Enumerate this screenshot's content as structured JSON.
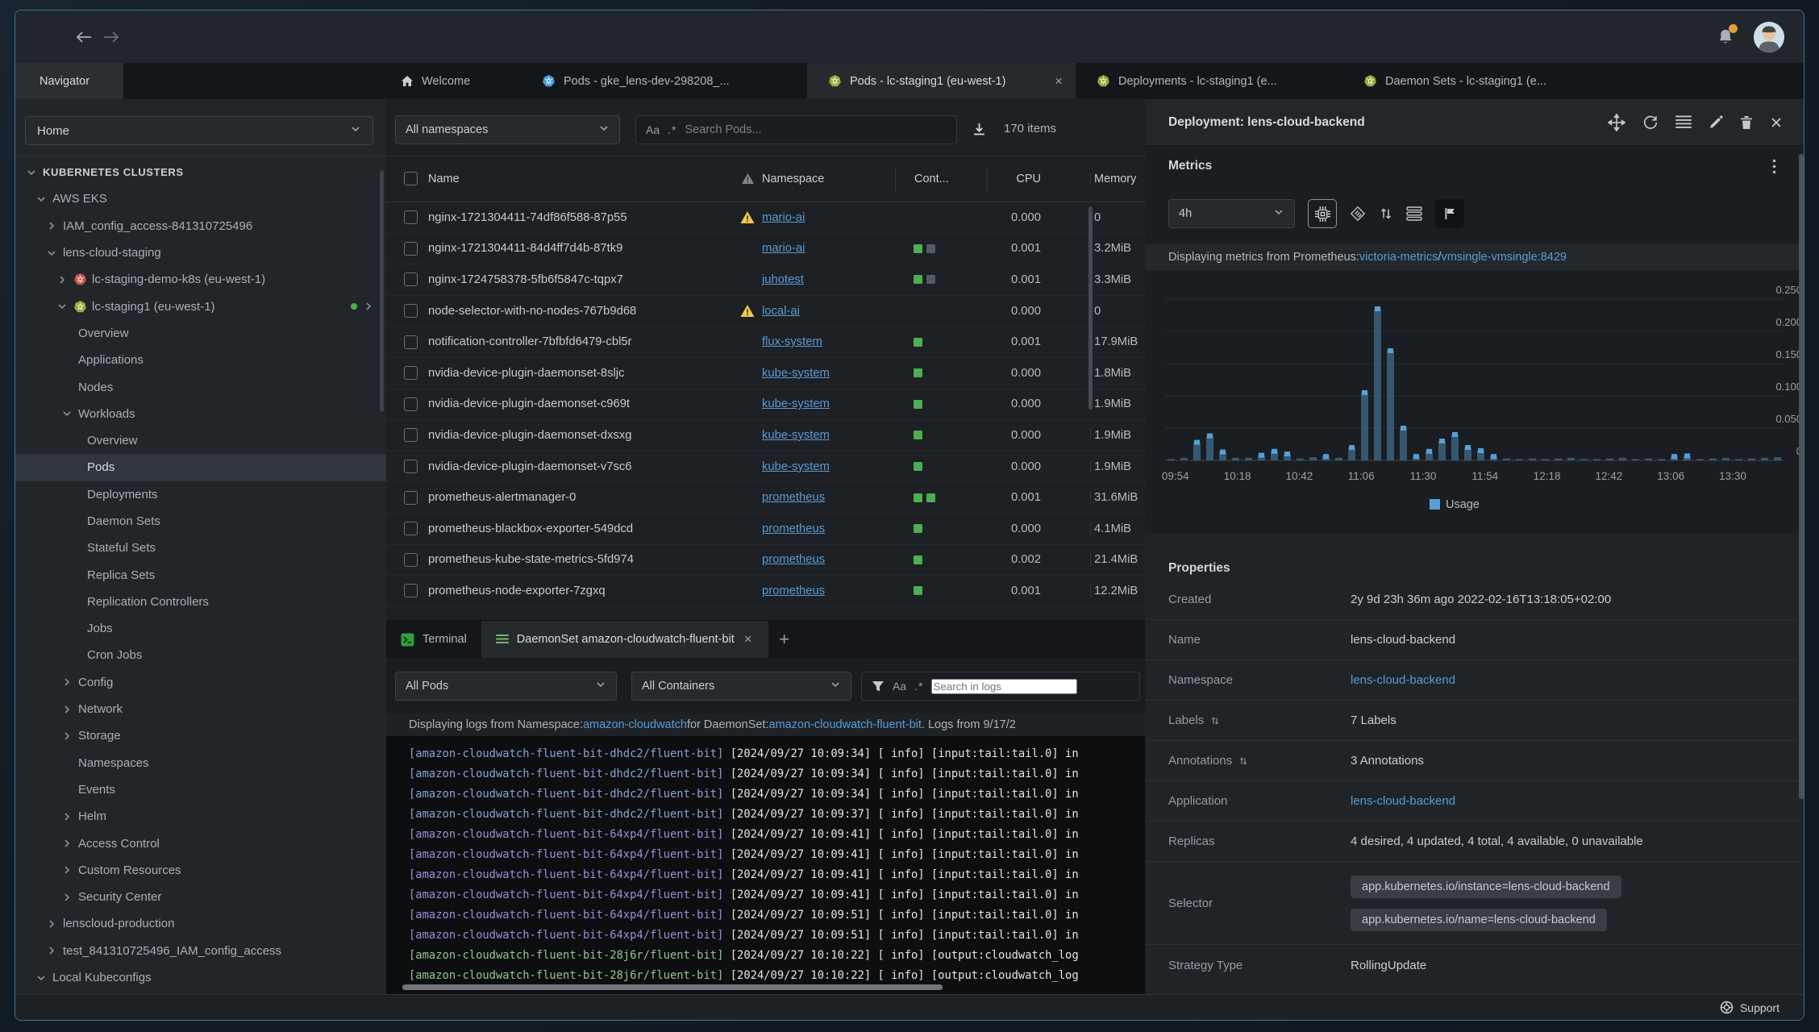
{
  "tabstrip": {
    "navigator_label": "Navigator",
    "tabs": [
      {
        "id": "welcome",
        "icon": "home",
        "label": "Welcome",
        "active": false,
        "closable": false
      },
      {
        "id": "pods-gke",
        "icon": "k8s-blue",
        "label": "Pods - gke_lens-dev-298208_...",
        "active": false,
        "closable": false
      },
      {
        "id": "pods-lc-staging1",
        "icon": "k8s-green",
        "label": "Pods - lc-staging1 (eu-west-1)",
        "active": true,
        "closable": true
      },
      {
        "id": "deployments-lc-staging1",
        "icon": "k8s-green",
        "label": "Deployments - lc-staging1 (e...",
        "active": false,
        "closable": false
      },
      {
        "id": "daemonsets-lc-staging1",
        "icon": "k8s-green",
        "label": "Daemon Sets - lc-staging1 (e...",
        "active": false,
        "closable": false
      }
    ]
  },
  "sidebar": {
    "catalog_value": "Home",
    "tree": [
      {
        "label": "KUBERNETES CLUSTERS",
        "indent": 12,
        "chevron": "down",
        "section": true
      },
      {
        "label": "AWS EKS",
        "indent": 24,
        "chevron": "down"
      },
      {
        "label": "IAM_config_access-841310725496",
        "indent": 37,
        "chevron": "right"
      },
      {
        "label": "lens-cloud-staging",
        "indent": 37,
        "chevron": "down"
      },
      {
        "label": "lc-staging-demo-k8s (eu-west-1)",
        "indent": 50,
        "chevron": "right",
        "icon": "k8s-red"
      },
      {
        "label": "lc-staging1 (eu-west-1)",
        "indent": 50,
        "chevron": "down",
        "icon": "k8s-green",
        "status_dot": true
      },
      {
        "label": "Overview",
        "indent": 56
      },
      {
        "label": "Applications",
        "indent": 56
      },
      {
        "label": "Nodes",
        "indent": 56
      },
      {
        "label": "Workloads",
        "indent": 56,
        "chevron": "down"
      },
      {
        "label": "Overview",
        "indent": 67
      },
      {
        "label": "Pods",
        "indent": 67,
        "selected": true
      },
      {
        "label": "Deployments",
        "indent": 67
      },
      {
        "label": "Daemon Sets",
        "indent": 67
      },
      {
        "label": "Stateful Sets",
        "indent": 67
      },
      {
        "label": "Replica Sets",
        "indent": 67
      },
      {
        "label": "Replication Controllers",
        "indent": 67
      },
      {
        "label": "Jobs",
        "indent": 67
      },
      {
        "label": "Cron Jobs",
        "indent": 67
      },
      {
        "label": "Config",
        "indent": 56,
        "chevron": "right"
      },
      {
        "label": "Network",
        "indent": 56,
        "chevron": "right"
      },
      {
        "label": "Storage",
        "indent": 56,
        "chevron": "right"
      },
      {
        "label": "Namespaces",
        "indent": 56
      },
      {
        "label": "Events",
        "indent": 56
      },
      {
        "label": "Helm",
        "indent": 56,
        "chevron": "right"
      },
      {
        "label": "Access Control",
        "indent": 56,
        "chevron": "right"
      },
      {
        "label": "Custom Resources",
        "indent": 56,
        "chevron": "right"
      },
      {
        "label": "Security Center",
        "indent": 56,
        "chevron": "right"
      },
      {
        "label": "lenscloud-production",
        "indent": 37,
        "chevron": "right"
      },
      {
        "label": "test_841310725496_IAM_config_access",
        "indent": 37,
        "chevron": "right"
      },
      {
        "label": "Local Kubeconfigs",
        "indent": 24,
        "chevron": "down"
      }
    ]
  },
  "pods_view": {
    "namespace_filter": "All namespaces",
    "match_case_glyph": "Aa",
    "regex_glyph": ".*",
    "search_placeholder": "Search Pods...",
    "items_count": "170 items",
    "columns": {
      "name": "Name",
      "namespace": "Namespace",
      "containers": "Cont...",
      "cpu": "CPU",
      "memory": "Memory"
    },
    "container_colors": {
      "green": "#4caf50",
      "gray": "#535a61"
    },
    "rows": [
      {
        "name": "nginx-1721304411-74df86f588-87p55",
        "warning": true,
        "namespace": "mario-ai",
        "containers": [],
        "cpu": "0.000",
        "memory": "0"
      },
      {
        "name": "nginx-1721304411-84d4ff7d4b-87tk9",
        "warning": false,
        "namespace": "mario-ai",
        "containers": [
          "green",
          "gray"
        ],
        "cpu": "0.001",
        "memory": "3.2MiB"
      },
      {
        "name": "nginx-1724758378-5fb6f5847c-tqpx7",
        "warning": false,
        "namespace": "juhotest",
        "containers": [
          "green",
          "gray"
        ],
        "cpu": "0.001",
        "memory": "3.3MiB"
      },
      {
        "name": "node-selector-with-no-nodes-767b9d68",
        "warning": true,
        "namespace": "local-ai",
        "containers": [],
        "cpu": "0.000",
        "memory": "0"
      },
      {
        "name": "notification-controller-7bfbfd6479-cbl5r",
        "warning": false,
        "namespace": "flux-system",
        "containers": [
          "green"
        ],
        "cpu": "0.001",
        "memory": "17.9MiB"
      },
      {
        "name": "nvidia-device-plugin-daemonset-8sljc",
        "warning": false,
        "namespace": "kube-system",
        "containers": [
          "green"
        ],
        "cpu": "0.000",
        "memory": "1.8MiB"
      },
      {
        "name": "nvidia-device-plugin-daemonset-c969t",
        "warning": false,
        "namespace": "kube-system",
        "containers": [
          "green"
        ],
        "cpu": "0.000",
        "memory": "1.9MiB"
      },
      {
        "name": "nvidia-device-plugin-daemonset-dxsxg",
        "warning": false,
        "namespace": "kube-system",
        "containers": [
          "green"
        ],
        "cpu": "0.000",
        "memory": "1.9MiB"
      },
      {
        "name": "nvidia-device-plugin-daemonset-v7sc6",
        "warning": false,
        "namespace": "kube-system",
        "containers": [
          "green"
        ],
        "cpu": "0.000",
        "memory": "1.9MiB"
      },
      {
        "name": "prometheus-alertmanager-0",
        "warning": false,
        "namespace": "prometheus",
        "containers": [
          "green",
          "green"
        ],
        "cpu": "0.001",
        "memory": "31.6MiB"
      },
      {
        "name": "prometheus-blackbox-exporter-549dcd",
        "warning": false,
        "namespace": "prometheus",
        "containers": [
          "green"
        ],
        "cpu": "0.000",
        "memory": "4.1MiB"
      },
      {
        "name": "prometheus-kube-state-metrics-5fd974",
        "warning": false,
        "namespace": "prometheus",
        "containers": [
          "green"
        ],
        "cpu": "0.002",
        "memory": "21.4MiB"
      },
      {
        "name": "prometheus-node-exporter-7zgxq",
        "warning": false,
        "namespace": "prometheus",
        "containers": [
          "green"
        ],
        "cpu": "0.001",
        "memory": "12.2MiB"
      }
    ]
  },
  "dock": {
    "tabs": [
      {
        "id": "terminal",
        "icon": "terminal",
        "label": "Terminal",
        "active": false,
        "closable": false
      },
      {
        "id": "daemonset-logs",
        "icon": "logs",
        "label": "DaemonSet amazon-cloudwatch-fluent-bit",
        "active": true,
        "closable": true
      }
    ],
    "pods_filter": "All Pods",
    "containers_filter": "All Containers",
    "match_case_glyph": "Aa",
    "regex_glyph": ".*",
    "search_placeholder": "Search in logs",
    "info_line": {
      "prefix": "Displaying logs from Namespace: ",
      "namespace_link": "amazon-cloudwatch",
      "middle": " for DaemonSet: ",
      "daemonset_link": "amazon-cloudwatch-fluent-bit",
      "suffix": ". Logs from 9/17/2"
    },
    "log_lines": [
      {
        "source": "amazon-cloudwatch-fluent-bit-dhdc2/fluent-bit",
        "color": "#8ba3d6",
        "message": "[2024/09/27 10:09:34] [ info] [input:tail:tail.0] in"
      },
      {
        "source": "amazon-cloudwatch-fluent-bit-dhdc2/fluent-bit",
        "color": "#8ba3d6",
        "message": "[2024/09/27 10:09:34] [ info] [input:tail:tail.0] in"
      },
      {
        "source": "amazon-cloudwatch-fluent-bit-dhdc2/fluent-bit",
        "color": "#8ba3d6",
        "message": "[2024/09/27 10:09:34] [ info] [input:tail:tail.0] in"
      },
      {
        "source": "amazon-cloudwatch-fluent-bit-dhdc2/fluent-bit",
        "color": "#8ba3d6",
        "message": "[2024/09/27 10:09:37] [ info] [input:tail:tail.0] in"
      },
      {
        "source": "amazon-cloudwatch-fluent-bit-64xp4/fluent-bit",
        "color": "#9b91d8",
        "message": "[2024/09/27 10:09:41] [ info] [input:tail:tail.0] in"
      },
      {
        "source": "amazon-cloudwatch-fluent-bit-64xp4/fluent-bit",
        "color": "#9b91d8",
        "message": "[2024/09/27 10:09:41] [ info] [input:tail:tail.0] in"
      },
      {
        "source": "amazon-cloudwatch-fluent-bit-64xp4/fluent-bit",
        "color": "#9b91d8",
        "message": "[2024/09/27 10:09:41] [ info] [input:tail:tail.0] in"
      },
      {
        "source": "amazon-cloudwatch-fluent-bit-64xp4/fluent-bit",
        "color": "#9b91d8",
        "message": "[2024/09/27 10:09:41] [ info] [input:tail:tail.0] in"
      },
      {
        "source": "amazon-cloudwatch-fluent-bit-64xp4/fluent-bit",
        "color": "#9b91d8",
        "message": "[2024/09/27 10:09:51] [ info] [input:tail:tail.0] in"
      },
      {
        "source": "amazon-cloudwatch-fluent-bit-64xp4/fluent-bit",
        "color": "#9b91d8",
        "message": "[2024/09/27 10:09:51] [ info] [input:tail:tail.0] in"
      },
      {
        "source": "amazon-cloudwatch-fluent-bit-28j6r/fluent-bit",
        "color": "#93c78f",
        "message": "[2024/09/27 10:10:22] [ info] [output:cloudwatch_log"
      },
      {
        "source": "amazon-cloudwatch-fluent-bit-28j6r/fluent-bit",
        "color": "#93c78f",
        "message": "[2024/09/27 10:10:22] [ info] [output:cloudwatch_log"
      }
    ]
  },
  "detail_panel": {
    "title": "Deployment: lens-cloud-backend",
    "metrics": {
      "title": "Metrics",
      "range_value": "4h",
      "source_line": {
        "prefix": "Displaying metrics from Prometheus: ",
        "link1": "victoria-metrics",
        "separator": " / ",
        "link2": "vmsingle-vmsingle:8429"
      }
    },
    "properties": {
      "title": "Properties",
      "rows": [
        {
          "label": "Created",
          "value": "2y 9d 23h 36m ago 2022-02-16T13:18:05+02:00"
        },
        {
          "label": "Name",
          "value": "lens-cloud-backend"
        },
        {
          "label": "Namespace",
          "value": "lens-cloud-backend",
          "link": true
        },
        {
          "label": "Labels",
          "value": "7 Labels",
          "sortable": true
        },
        {
          "label": "Annotations",
          "value": "3 Annotations",
          "sortable": true
        },
        {
          "label": "Application",
          "value": "lens-cloud-backend",
          "link": true
        },
        {
          "label": "Replicas",
          "value": "4 desired, 4 updated, 4 total, 4 available, 0 unavailable"
        },
        {
          "label": "Selector",
          "badges": [
            "app.kubernetes.io/instance=lens-cloud-backend",
            "app.kubernetes.io/name=lens-cloud-backend"
          ]
        },
        {
          "label": "Strategy Type",
          "value": "RollingUpdate"
        }
      ]
    }
  },
  "statusbar": {
    "support_label": "Support"
  },
  "chart_data": {
    "type": "bar",
    "series": [
      {
        "name": "Usage",
        "color": "#4d86b0",
        "values": [
          0.002,
          0.004,
          0.028,
          0.038,
          0.013,
          0.004,
          0.004,
          0.008,
          0.014,
          0.01,
          0.003,
          0.005,
          0.006,
          0.004,
          0.02,
          0.105,
          0.235,
          0.17,
          0.05,
          0.006,
          0.014,
          0.03,
          0.04,
          0.02,
          0.015,
          0.006,
          0.003,
          0.002,
          0.003,
          0.002,
          0.003,
          0.004,
          0.002,
          0.002,
          0.003,
          0.004,
          0.002,
          0.003,
          0.002,
          0.006,
          0.007,
          0.002,
          0.003,
          0.004,
          0.002,
          0.003,
          0.004,
          0.005
        ]
      }
    ],
    "start_time": "09:50",
    "interval_minutes": 5,
    "x_tick_labels": [
      "09:54",
      "10:18",
      "10:42",
      "11:06",
      "11:30",
      "11:54",
      "12:18",
      "12:42",
      "13:06",
      "13:30"
    ],
    "ylim": [
      0,
      0.25
    ],
    "y_ticks": [
      0,
      0.05,
      0.1,
      0.15,
      0.2,
      0.25
    ],
    "grid": true,
    "legend_position": "bottom",
    "marker_color": "#56a0d8"
  }
}
